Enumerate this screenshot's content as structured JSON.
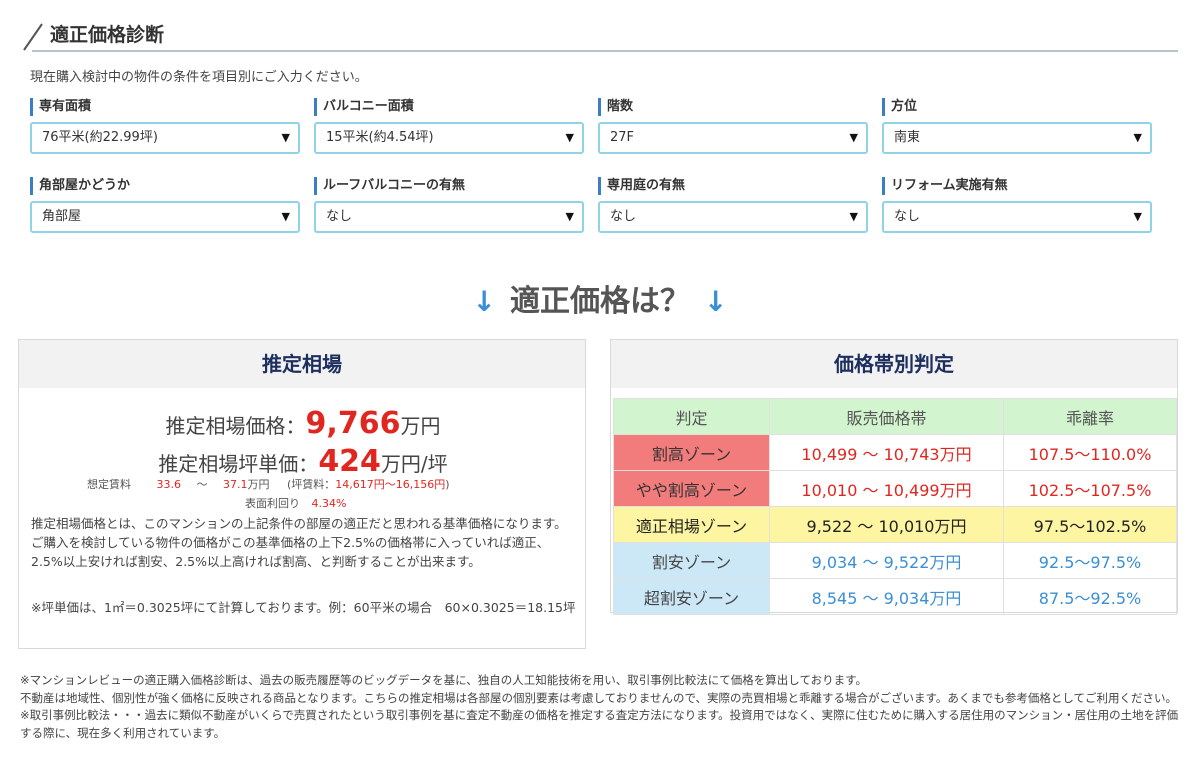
{
  "header": {
    "title": "適正価格診断"
  },
  "intro": "現在購入検討中の物件の条件を項目別にご入力ください。",
  "fields": [
    {
      "label": "専有面積",
      "value": "76平米(約22.99坪)"
    },
    {
      "label": "バルコニー面積",
      "value": "15平米(約4.54坪)"
    },
    {
      "label": "階数",
      "value": "27F"
    },
    {
      "label": "方位",
      "value": "南東"
    },
    {
      "label": "角部屋かどうか",
      "value": "角部屋"
    },
    {
      "label": "ルーフバルコニーの有無",
      "value": "なし"
    },
    {
      "label": "専用庭の有無",
      "value": "なし"
    },
    {
      "label": "リフォーム実施有無",
      "value": "なし"
    }
  ],
  "caret": "▼",
  "question": {
    "arrow": "↓",
    "text": "適正価格は？"
  },
  "estimate": {
    "title": "推定相場",
    "price_label": "推定相場価格：",
    "price_value": "9,766",
    "price_unit": "万円",
    "tsubo_label": "推定相場坪単価：",
    "tsubo_value": "424",
    "tsubo_unit": "万円/坪",
    "rent_label": "想定賃料",
    "rent_min": "33.6",
    "rent_sep": "～",
    "rent_max": "37.1",
    "rent_unit": "万円",
    "rent_tsubo_prefix": "(坪賃料：",
    "rent_tsubo": "14,617円～16,156円",
    "rent_tsubo_suffix": ")",
    "yield_label": "表面利回り",
    "yield_value": "4.34%",
    "description": "推定相場価格とは、このマンションの上記条件の部屋の適正だと思われる基準価格になります。ご購入を検討している物件の価格がこの基準価格の上下2.5%の価格帯に入っていれば適正、2.5%以上安ければ割安、2.5%以上高ければ割高、と判断することが出来ます。",
    "note": "※坪単価は、1㎡＝0.3025坪にて計算しております。例：60平米の場合　60×0.3025＝18.15坪"
  },
  "zones": {
    "title": "価格帯別判定",
    "headers": [
      "判定",
      "販売価格帯",
      "乖離率"
    ],
    "rows": [
      {
        "name": "割高ゾーン",
        "range": "10,499 ～ 10,743万円",
        "rate": "107.5～110.0%"
      },
      {
        "name": "やや割高ゾーン",
        "range": "10,010 ～ 10,499万円",
        "rate": "102.5～107.5%"
      },
      {
        "name": "適正相場ゾーン",
        "range": "9,522 ～ 10,010万円",
        "rate": "97.5～102.5%"
      },
      {
        "name": "割安ゾーン",
        "range": "9,034 ～ 9,522万円",
        "rate": "92.5～97.5%"
      },
      {
        "name": "超割安ゾーン",
        "range": "8,545 ～ 9,034万円",
        "rate": "87.5～92.5%"
      }
    ],
    "colors": {
      "high": "#f27b7b",
      "fair": "#fdf5a1",
      "cheap": "#cce8f7",
      "header": "#d2f5cf"
    }
  },
  "footer": [
    "※マンションレビューの適正購入価格診断は、過去の販売履歴等のビッグデータを基に、独自の人工知能技術を用い、取引事例比較法にて価格を算出しております。",
    "不動産は地域性、個別性が強く価格に反映される商品となります。こちらの推定相場は各部屋の個別要素は考慮しておりませんので、実際の売買相場と乖離する場合がございます。あくまでも参考価格としてご利用ください。",
    "※取引事例比較法・・・過去に類似不動産がいくらで売買されたという取引事例を基に査定不動産の価格を推定する査定方法になります。投資用ではなく、実際に住むために購入する居住用のマンション・居住用の土地を評価する際に、現在多く利用されています。"
  ]
}
